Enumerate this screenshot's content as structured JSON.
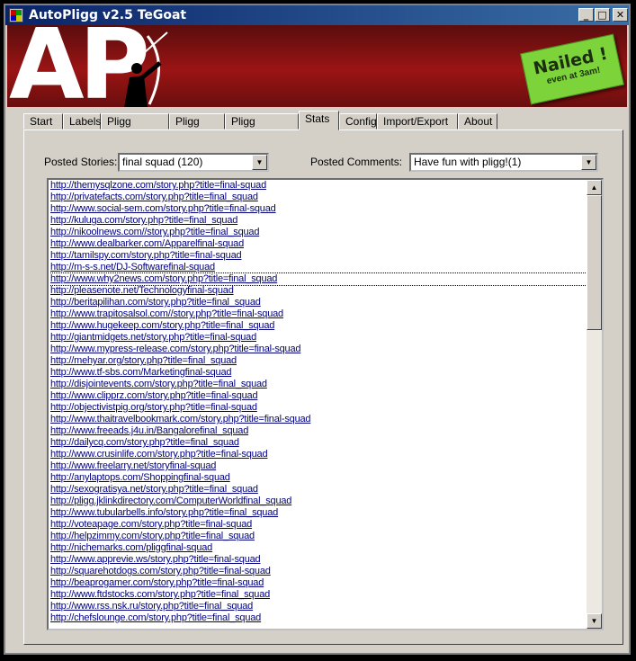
{
  "window": {
    "title": "AutoPligg v2.5 TeGoat"
  },
  "banner": {
    "logo": "AP",
    "sticker_main": "Nailed !",
    "sticker_sub": "even at 3am!"
  },
  "tabs": [
    {
      "label": "Start"
    },
    {
      "label": "Labels"
    },
    {
      "label": "Pligg Register"
    },
    {
      "label": "Pligg Story"
    },
    {
      "label": "Pligg Comment"
    },
    {
      "label": "Stats",
      "active": true
    },
    {
      "label": "Config"
    },
    {
      "label": "Import/Export"
    },
    {
      "label": "About"
    }
  ],
  "stats": {
    "posted_stories_label": "Posted Stories:",
    "posted_stories_value": "final squad (120)",
    "posted_comments_label": "Posted Comments:",
    "posted_comments_value": "Have fun with pligg!(1)"
  },
  "links": [
    "http://themysqlzone.com/story.php?title=final-squad",
    "http://privatefacts.com/story.php?title=final_squad",
    "http://www.social-sem.com/story.php?title=final-squad",
    "http://kuluga.com/story.php?title=final_squad",
    "http://nikoolnews.com//story.php?title=final_squad",
    "http://www.dealbarker.com/Apparelfinal-squad",
    "http://tamilspy.com/story.php?title=final-squad",
    "http://m-s-s.net/DJ-Softwarefinal-squad",
    "http://www.why2news.com/story.php?title=final_squad",
    "http://pleasenote.net/Technologyfinal-squad",
    "http://beritapilihan.com/story.php?title=final_squad",
    "http://www.trapitosalsol.com//story.php?title=final-squad",
    "http://www.hugekeep.com/story.php?title=final_squad",
    "http://giantmidgets.net/story.php?title=final-squad",
    "http://www.mypress-release.com/story.php?title=final-squad",
    "http://mehyar.org/story.php?title=final_squad",
    "http://www.tf-sbs.com/Marketingfinal-squad",
    "http://disjointevents.com/story.php?title=final_squad",
    "http://www.clipprz.com/story.php?title=final-squad",
    "http://objectivistpig.org/story.php?title=final-squad",
    "http://www.thaitravelbookmark.com/story.php?title=final-squad",
    "http://www.freeads.j4u.in/Bangalorefinal_squad",
    "http://dailycq.com/story.php?title=final_squad",
    "http://www.crusinlife.com/story.php?title=final-squad",
    "http://www.freelarry.net/storyfinal-squad",
    "http://anylaptops.com/Shoppingfinal-squad",
    "http://sexogratisya.net/story.php?title=final_squad",
    "http://pligg.jklinkdirectory.com/ComputerWorldfinal_squad",
    "http://www.tubularbells.info/story.php?title=final_squad",
    "http://voteapage.com/story.php?title=final-squad",
    "http://helpzimmy.com/story.php?title=final_squad",
    "http://nichemarks.com/pliggfinal-squad",
    "http://www.apprevie.ws/story.php?title=final-squad",
    "http://squarehotdogs.com/story.php?title=final-squad",
    "http://beaprogamer.com/story.php?title=final-squad",
    "http://www.ftdstocks.com/story.php?title=final_squad",
    "http://www.rss.nsk.ru/story.php?title=final_squad",
    "http://chefslounge.com/story.php?title=final_squad"
  ],
  "selected_index": 8
}
